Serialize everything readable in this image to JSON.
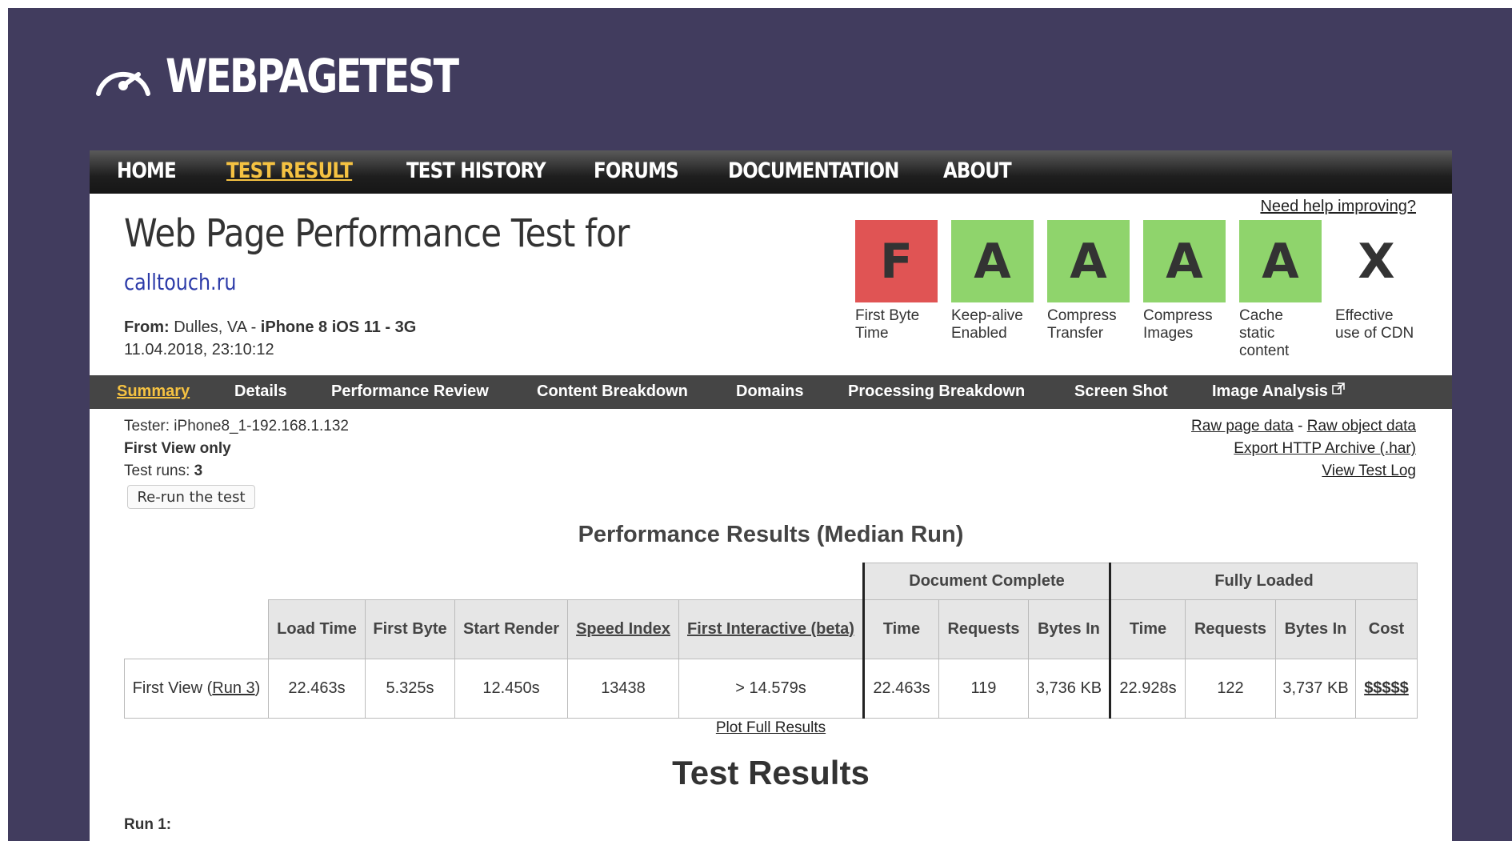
{
  "app": {
    "logo_text": "WEBPAGETEST"
  },
  "topnav": [
    {
      "label": "HOME",
      "active": false
    },
    {
      "label": "TEST RESULT",
      "active": true
    },
    {
      "label": "TEST HISTORY",
      "active": false
    },
    {
      "label": "FORUMS",
      "active": false
    },
    {
      "label": "DOCUMENTATION",
      "active": false
    },
    {
      "label": "ABOUT",
      "active": false
    }
  ],
  "header": {
    "title": "Web Page Performance Test for",
    "url": "calltouch.ru",
    "from_label": "From:",
    "from_location": " Dulles, VA - ",
    "from_device": "iPhone 8 iOS 11 - 3G",
    "date": "11.04.2018, 23:10:12",
    "help_link": "Need help improving?"
  },
  "grades": [
    {
      "grade": "F",
      "label": "First Byte\nTime",
      "color": "#e05454"
    },
    {
      "grade": "A",
      "label": "Keep-alive\nEnabled",
      "color": "#8fd46c"
    },
    {
      "grade": "A",
      "label": "Compress\nTransfer",
      "color": "#8fd46c"
    },
    {
      "grade": "A",
      "label": "Compress\nImages",
      "color": "#8fd46c"
    },
    {
      "grade": "A",
      "label": "Cache\nstatic\ncontent",
      "color": "#8fd46c"
    },
    {
      "grade": "X",
      "label": "Effective\nuse of CDN",
      "color": "#ffffff"
    }
  ],
  "subnav": [
    {
      "label": "Summary",
      "active": true
    },
    {
      "label": "Details",
      "active": false
    },
    {
      "label": "Performance Review",
      "active": false
    },
    {
      "label": "Content Breakdown",
      "active": false
    },
    {
      "label": "Domains",
      "active": false
    },
    {
      "label": "Processing Breakdown",
      "active": false
    },
    {
      "label": "Screen Shot",
      "active": false
    },
    {
      "label": "Image Analysis",
      "active": false
    }
  ],
  "test_info": {
    "tester": "Tester: iPhone8_1-192.168.1.132",
    "view": "First View only",
    "runs_label": "Test runs: ",
    "runs_value": "3",
    "rerun_button": "Re-run the test"
  },
  "right_links": {
    "raw_page": "Raw page data",
    "separator": " - ",
    "raw_object": "Raw object data",
    "har": "Export HTTP Archive (.har)",
    "log": "View Test Log"
  },
  "perf": {
    "title": "Performance Results (Median Run)",
    "group_doc": "Document Complete",
    "group_full": "Fully Loaded",
    "headers": {
      "load_time": "Load Time",
      "first_byte": "First Byte",
      "start_render": "Start Render",
      "speed_index": "Speed Index",
      "first_interactive": "First Interactive (beta)",
      "doc_time": "Time",
      "doc_requests": "Requests",
      "doc_bytes": "Bytes In",
      "full_time": "Time",
      "full_requests": "Requests",
      "full_bytes": "Bytes In",
      "cost": "Cost"
    },
    "row": {
      "label_prefix": "First View (",
      "label_link": "Run 3",
      "label_suffix": ")",
      "load_time": "22.463s",
      "first_byte": "5.325s",
      "start_render": "12.450s",
      "speed_index": "13438",
      "first_interactive": "> 14.579s",
      "doc_time": "22.463s",
      "doc_requests": "119",
      "doc_bytes": "3,736 KB",
      "full_time": "22.928s",
      "full_requests": "122",
      "full_bytes": "3,737 KB",
      "cost": "$$$$$"
    },
    "plot_link": "Plot Full Results"
  },
  "results": {
    "title": "Test Results",
    "run1": "Run 1:"
  }
}
